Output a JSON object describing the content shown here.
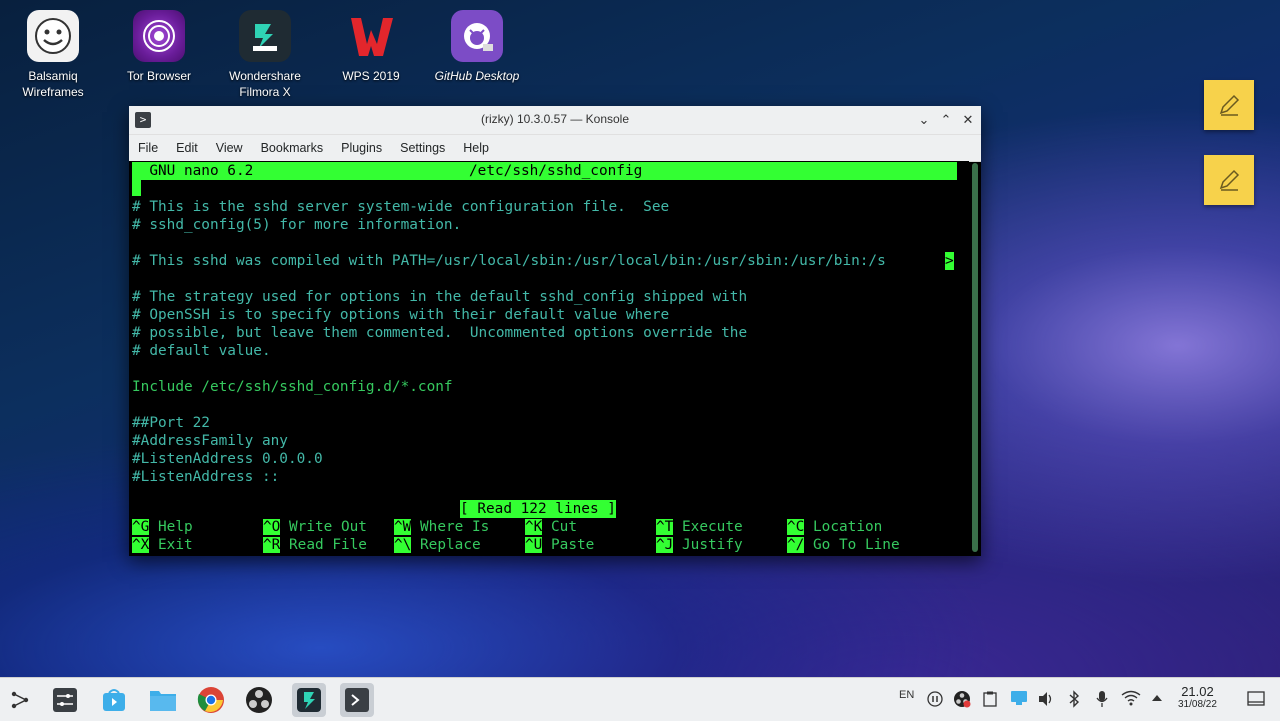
{
  "desktop": {
    "icons": [
      {
        "label1": "Balsamiq",
        "label2": "Wireframes",
        "icon": "balsamiq-icon"
      },
      {
        "label1": "Tor Browser",
        "label2": "",
        "icon": "tor-icon"
      },
      {
        "label1": "Wondershare",
        "label2": "Filmora X",
        "icon": "filmora-icon"
      },
      {
        "label1": "WPS 2019",
        "label2": "",
        "icon": "wps-icon"
      },
      {
        "label1": "GitHub Desktop",
        "label2": "",
        "icon": "github-icon"
      }
    ]
  },
  "window": {
    "title": "(rizky) 10.3.0.57 — Konsole",
    "menu": [
      "File",
      "Edit",
      "View",
      "Bookmarks",
      "Plugins",
      "Settings",
      "Help"
    ]
  },
  "nano": {
    "version": "  GNU nano 6.2",
    "filename": "/etc/ssh/sshd_config",
    "lines": [
      "# This is the sshd server system-wide configuration file.  See",
      "# sshd_config(5) for more information.",
      "",
      "# This sshd was compiled with PATH=/usr/local/sbin:/usr/local/bin:/usr/sbin:/usr/bin:/s",
      "",
      "# The strategy used for options in the default sshd_config shipped with",
      "# OpenSSH is to specify options with their default value where",
      "# possible, but leave them commented.  Uncommented options override the",
      "# default value.",
      "",
      "Include /etc/ssh/sshd_config.d/*.conf",
      "",
      "##Port 22",
      "#AddressFamily any",
      "#ListenAddress 0.0.0.0",
      "#ListenAddress ::"
    ],
    "overflow_marker": ">",
    "status": "[ Read 122 lines ]",
    "shortcuts_row1": [
      {
        "key": "^G",
        "label": "Help"
      },
      {
        "key": "^O",
        "label": "Write Out"
      },
      {
        "key": "^W",
        "label": "Where Is"
      },
      {
        "key": "^K",
        "label": "Cut"
      },
      {
        "key": "^T",
        "label": "Execute"
      },
      {
        "key": "^C",
        "label": "Location"
      }
    ],
    "shortcuts_row2": [
      {
        "key": "^X",
        "label": "Exit"
      },
      {
        "key": "^R",
        "label": "Read File"
      },
      {
        "key": "^\\",
        "label": "Replace"
      },
      {
        "key": "^U",
        "label": "Paste"
      },
      {
        "key": "^J",
        "label": "Justify"
      },
      {
        "key": "^/",
        "label": "Go To Line"
      }
    ]
  },
  "taskbar": {
    "lang": "EN",
    "time": "21.02",
    "date": "31/08/22"
  }
}
